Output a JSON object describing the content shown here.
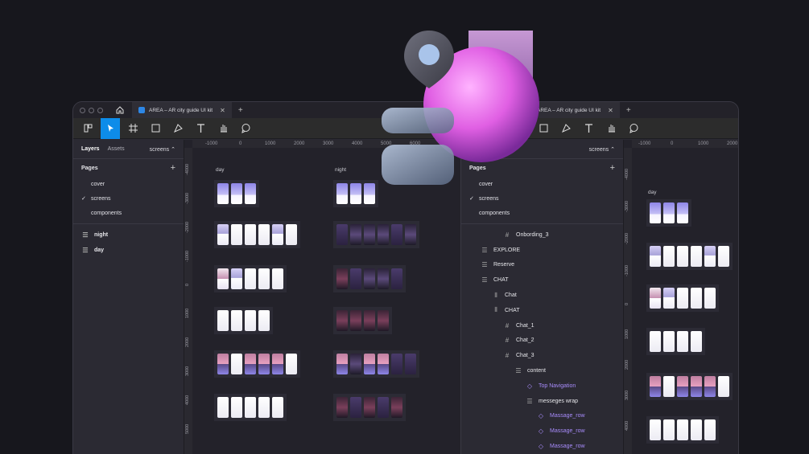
{
  "window1": {
    "tab_title": "AREA – AR city guide UI kit",
    "sidebar": {
      "tabs": [
        "Layers",
        "Assets"
      ],
      "page_selector": "screens ⌃",
      "pages_title": "Pages",
      "pages": [
        "cover",
        "screens",
        "components"
      ],
      "layers": [
        "night",
        "day"
      ]
    },
    "ruler_top": [
      "-1000",
      "0",
      "1000",
      "2000",
      "3000",
      "4000",
      "5000",
      "6000"
    ],
    "ruler_left": [
      "-4000",
      "-3000",
      "-2000",
      "-1000",
      "0",
      "1000",
      "2000",
      "3000",
      "4000",
      "5000"
    ],
    "canvas_labels": [
      "day",
      "night"
    ]
  },
  "window2": {
    "tab_title": "AREA – AR city guide UI kit",
    "sidebar": {
      "tabs": [
        "Layers",
        "Assets"
      ],
      "page_selector": "screens ⌃",
      "pages_title": "Pages",
      "pages": [
        "cover",
        "screens",
        "components"
      ],
      "layers": [
        "Onbording_3",
        "EXPLORE",
        "Reserve",
        "CHAT",
        "Chat",
        "CHAT",
        "Chat_1",
        "Chat_2",
        "Chat_3",
        "content",
        "Top Navigation",
        "messeges wrap",
        "Massage_row",
        "Massage_row",
        "Massage_row"
      ]
    },
    "ruler_top": [
      "-1000",
      "0",
      "1000",
      "2000"
    ],
    "ruler_left": [
      "-4000",
      "-3000",
      "-2000",
      "-1000",
      "0",
      "1000",
      "2000",
      "3000",
      "4000"
    ],
    "canvas_labels": [
      "day"
    ]
  },
  "colors": {
    "accent": "#0d8ce9",
    "component": "#a78bfa",
    "background": "#17171d"
  }
}
